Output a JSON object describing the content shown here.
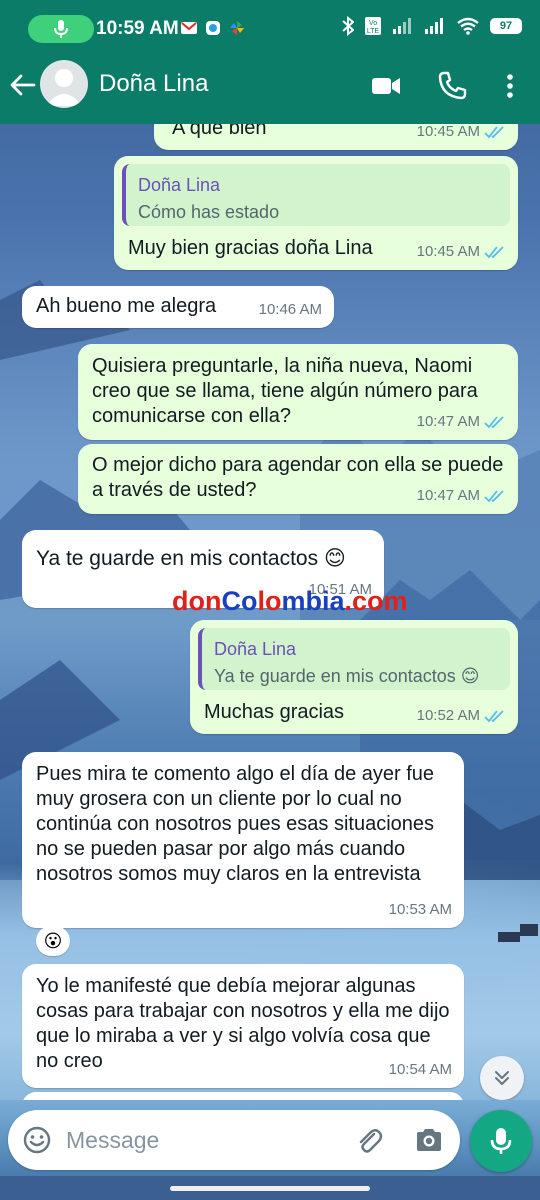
{
  "status_bar": {
    "time": "10:59 AM",
    "battery": "97",
    "volte": "Vo LTE",
    "icons": [
      "mic-icon",
      "gmail-icon",
      "notification-icon",
      "pinwheel-icon",
      "bluetooth-icon",
      "signal-icon",
      "wifi-icon",
      "battery-icon"
    ]
  },
  "header": {
    "contact_name": "Doña Lina",
    "icons": [
      "back-arrow-icon",
      "avatar-icon",
      "video-call-icon",
      "phone-icon",
      "more-vert-icon"
    ]
  },
  "messages": [
    {
      "dir": "out",
      "text": "A que bien",
      "time": "10:45 AM",
      "status": "read"
    },
    {
      "dir": "out",
      "quote_name": "Doña Lina",
      "quote_text": "Cómo has estado",
      "text": "Muy bien gracias doña Lina",
      "time": "10:45 AM",
      "status": "read"
    },
    {
      "dir": "in",
      "text": "Ah bueno me alegra",
      "time": "10:46 AM"
    },
    {
      "dir": "out",
      "text": "Quisiera preguntarle, la niña nueva, Naomi creo que se llama, tiene algún número para comunicarse con ella?",
      "time": "10:47 AM",
      "status": "read"
    },
    {
      "dir": "out",
      "text": "O mejor dicho para agendar con ella se puede a través de usted?",
      "time": "10:47 AM",
      "status": "read"
    },
    {
      "dir": "in",
      "text": "Ya te guarde en mis contactos 😊",
      "time": "10:51 AM"
    },
    {
      "dir": "out",
      "quote_name": "Doña Lina",
      "quote_text": "Ya te guarde en mis contactos 😊",
      "text": "Muchas gracias",
      "time": "10:52 AM",
      "status": "read"
    },
    {
      "dir": "in",
      "text": "Pues mira te comento algo el día de ayer fue muy grosera con un cliente por lo cual no continúa con nosotros pues esas situaciones no se pueden pasar por algo más cuando nosotros somos muy claros en la entrevista",
      "time": "10:53 AM",
      "reaction": "😮"
    },
    {
      "dir": "in",
      "text": "Yo le manifesté que debía mejorar algunas cosas para trabajar con nosotros y ella me dijo que lo miraba a ver y si algo volvía cosa que no creo",
      "time": "10:54 AM"
    }
  ],
  "watermark": {
    "parts": [
      "don",
      "Co",
      "lo",
      "mbia",
      ".com"
    ],
    "colors": [
      "#e0201b",
      "#1a3fbf",
      "#e0201b",
      "#1a3fbf",
      "#e0201b"
    ]
  },
  "composer": {
    "placeholder": "Message",
    "icons": [
      "emoji-icon",
      "attach-icon",
      "camera-icon",
      "mic-icon"
    ]
  },
  "colors": {
    "header": "#0b7c68",
    "outgoing_bubble": "#e7ffdb",
    "incoming_bubble": "#ffffff",
    "read_ticks": "#53bdeb",
    "send_button": "#14a784"
  }
}
